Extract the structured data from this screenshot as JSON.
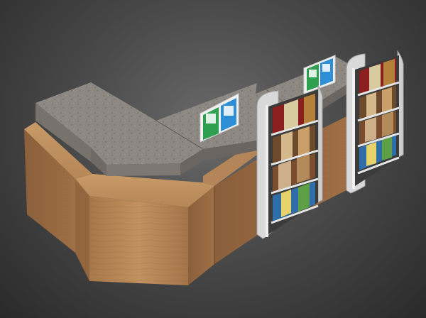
{
  "scene": {
    "subject": "retail-counter-with-display-shelves",
    "colors": {
      "background": "#4a4a4a",
      "wood": "#b8875a",
      "wood_dark": "#8e6440",
      "granite": "#8a8580",
      "shelf_frame": "#d9d9d9",
      "sign_green": "#2e9e4f",
      "sign_blue": "#2f8fd6"
    }
  }
}
